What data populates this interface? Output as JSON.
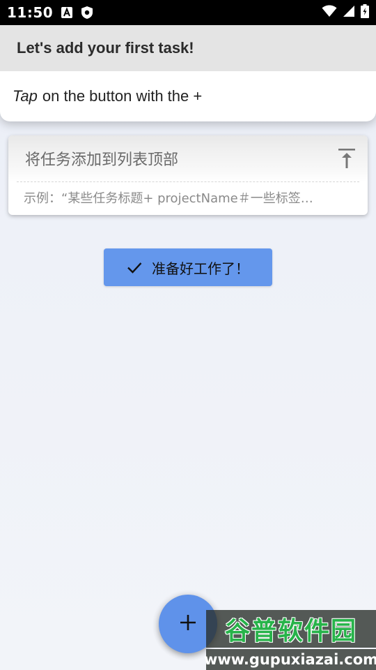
{
  "status_bar": {
    "time": "11:50",
    "left_icons": [
      "font-a-icon",
      "shield-icon"
    ],
    "right_icons": [
      "wifi-icon",
      "cellular-icon",
      "battery-icon"
    ]
  },
  "tutorial": {
    "title": "Let's add your first task!",
    "body_emphasis": "Tap",
    "body_rest": "on the button with the +"
  },
  "add_task": {
    "placeholder": "将任务添加到列表顶部",
    "example": "示例：“某些任务标题+ projectName＃一些标签…",
    "to_top_icon": "vertical-align-top-icon"
  },
  "ready_button": {
    "label": "准备好工作了！",
    "icon": "check-icon"
  },
  "fab": {
    "icon": "plus-icon"
  },
  "watermark": {
    "title": "谷普软件园",
    "url": "www.gupuxiazai.com"
  },
  "colors": {
    "accent": "#6497ec",
    "fab": "#5f92ea",
    "watermark_green": "#27b34a"
  }
}
